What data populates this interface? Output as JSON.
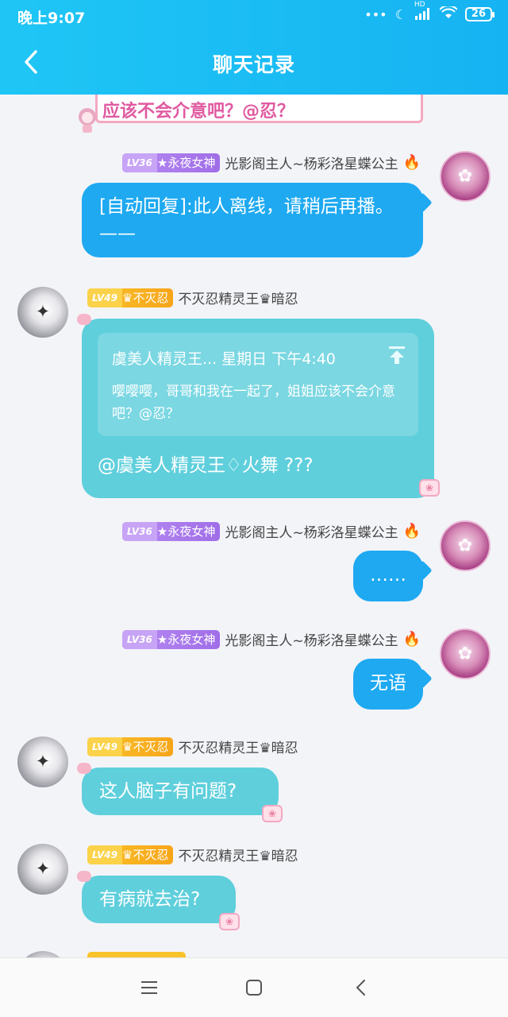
{
  "status": {
    "time": "晚上9:07",
    "battery": "26",
    "network_label": "HD"
  },
  "nav": {
    "title": "聊天记录"
  },
  "top_card": {
    "text": "应该不会介意吧？@忍？"
  },
  "messages": [
    {
      "side": "right",
      "badge_level": "LV36",
      "badge_title": "★永夜女神",
      "name": "光影阁主人~杨彩洛星蝶公主",
      "text": "[自动回复]:此人离线，请稍后再播。——",
      "color": "#1ea9f1"
    },
    {
      "side": "left",
      "badge_level": "LV49",
      "badge_title": "♛不灭忍",
      "name": "不灭忍精灵王♛暗忍",
      "quote_head": "虞美人精灵王... 星期日  下午4:40",
      "quote_text": "嘤嘤嘤，哥哥和我在一起了，姐姐应该不会介意吧？@忍？",
      "text": "@虞美人精灵王♢火舞 ???",
      "color": "#5fcfdc"
    },
    {
      "side": "right",
      "badge_level": "LV36",
      "badge_title": "★永夜女神",
      "name": "光影阁主人~杨彩洛星蝶公主",
      "text": "……"
    },
    {
      "side": "right",
      "badge_level": "LV36",
      "badge_title": "★永夜女神",
      "name": "光影阁主人~杨彩洛星蝶公主",
      "text": "无语"
    },
    {
      "side": "left",
      "badge_level": "LV49",
      "badge_title": "♛不灭忍",
      "name": "不灭忍精灵王♛暗忍",
      "text": "这人脑子有问题?"
    },
    {
      "side": "left",
      "badge_level": "LV49",
      "badge_title": "♛不灭忍",
      "name": "不灭忍精灵王♛暗忍",
      "text": "有病就去治?"
    }
  ],
  "bottom_nav": {
    "icons": [
      "menu-icon",
      "home-square-icon",
      "back-chevron-icon"
    ]
  }
}
